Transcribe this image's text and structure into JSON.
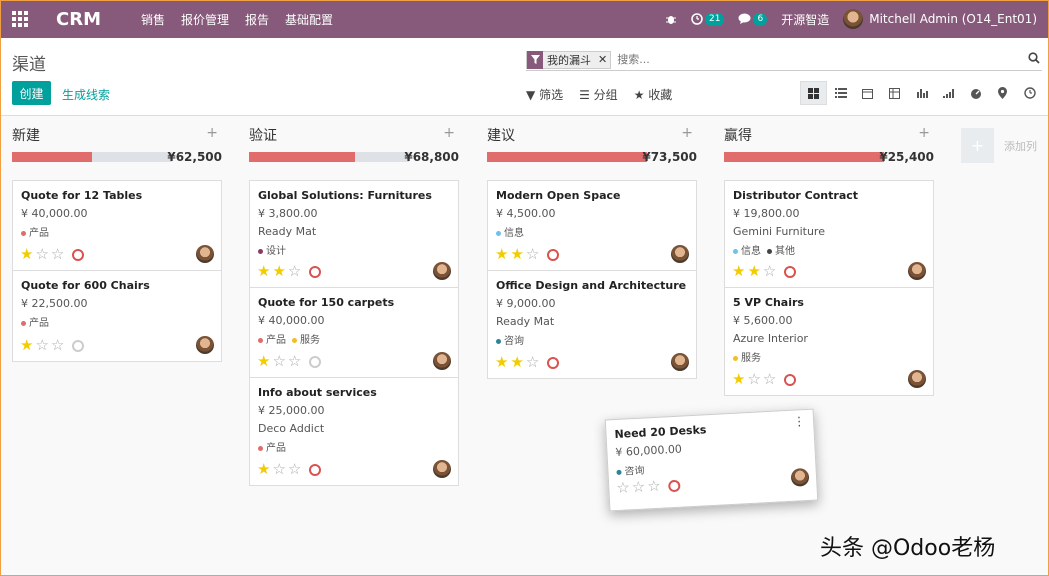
{
  "navbar": {
    "brand": "CRM",
    "menu": [
      "销售",
      "报价管理",
      "报告",
      "基础配置"
    ],
    "activity_count": "21",
    "message_count": "6",
    "company": "开源智造",
    "user": "Mitchell Admin (O14_Ent01)"
  },
  "control": {
    "breadcrumb": "渠道",
    "create_label": "创建",
    "lead_label": "生成线索",
    "facet": "我的漏斗",
    "search_placeholder": "搜索...",
    "filter_label": "筛选",
    "group_label": "分组",
    "favorite_label": "收藏"
  },
  "columns": [
    {
      "title": "新建",
      "total": "¥62,500",
      "progress": 0.5,
      "cards": [
        {
          "title": "Quote for 12 Tables",
          "amount": "¥ 40,000.00",
          "company": "",
          "tags": [
            {
              "label": "产品",
              "color": "#e06c6c"
            }
          ],
          "stars": 1,
          "clock": "red"
        },
        {
          "title": "Quote for 600 Chairs",
          "amount": "¥ 22,500.00",
          "company": "",
          "tags": [
            {
              "label": "产品",
              "color": "#e06c6c"
            }
          ],
          "stars": 1,
          "clock": "grey"
        }
      ]
    },
    {
      "title": "验证",
      "total": "¥68,800",
      "progress": 0.66,
      "cards": [
        {
          "title": "Global Solutions: Furnitures",
          "amount": "¥ 3,800.00",
          "company": "Ready Mat",
          "tags": [
            {
              "label": "设计",
              "color": "#8b3a62"
            }
          ],
          "stars": 2,
          "clock": "red"
        },
        {
          "title": "Quote for 150 carpets",
          "amount": "¥ 40,000.00",
          "company": "",
          "tags": [
            {
              "label": "产品",
              "color": "#e06c6c"
            },
            {
              "label": "服务",
              "color": "#f0c020"
            }
          ],
          "stars": 1,
          "clock": "grey"
        },
        {
          "title": "Info about services",
          "amount": "¥ 25,000.00",
          "company": "Deco Addict",
          "tags": [
            {
              "label": "产品",
              "color": "#e06c6c"
            }
          ],
          "stars": 1,
          "clock": "red"
        }
      ]
    },
    {
      "title": "建议",
      "total": "¥73,500",
      "progress": 1.0,
      "cards": [
        {
          "title": "Modern Open Space",
          "amount": "¥ 4,500.00",
          "company": "",
          "tags": [
            {
              "label": "信息",
              "color": "#6cc1ed"
            }
          ],
          "stars": 2,
          "clock": "red"
        },
        {
          "title": "Office Design and Architecture",
          "amount": "¥ 9,000.00",
          "company": "Ready Mat",
          "tags": [
            {
              "label": "咨询",
              "color": "#2c8397"
            }
          ],
          "stars": 2,
          "clock": "red"
        }
      ]
    },
    {
      "title": "赢得",
      "total": "¥25,400",
      "progress": 1.0,
      "cards": [
        {
          "title": "Distributor Contract",
          "amount": "¥ 19,800.00",
          "company": "Gemini Furniture",
          "tags": [
            {
              "label": "信息",
              "color": "#6cc1ed"
            },
            {
              "label": "其他",
              "color": "#444"
            }
          ],
          "stars": 2,
          "clock": "red"
        },
        {
          "title": "5 VP Chairs",
          "amount": "¥ 5,600.00",
          "company": "Azure Interior",
          "tags": [
            {
              "label": "服务",
              "color": "#f0c020"
            }
          ],
          "stars": 1,
          "clock": "red"
        }
      ]
    }
  ],
  "add_column_label": "添加列",
  "dragged_card": {
    "title": "Need 20 Desks",
    "amount": "¥ 60,000.00",
    "tag": "咨询",
    "tag_color": "#2c8397",
    "stars": 0
  },
  "watermark": "头条 @Odoo老杨"
}
